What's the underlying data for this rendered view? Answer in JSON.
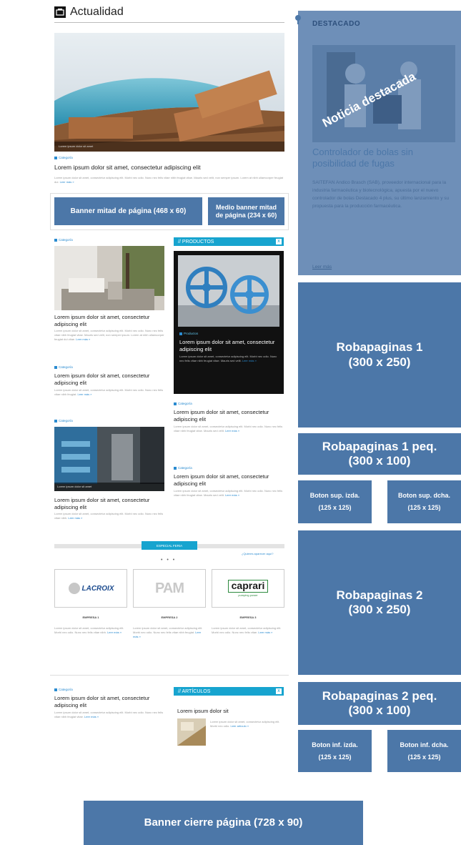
{
  "header": {
    "title": "Actualidad"
  },
  "hero": {
    "caption": "Lorem ipsum dolor sit amet",
    "category": "Categoría",
    "headline": "Lorem ipsum dolor sit amet, consectetur adipiscing elit",
    "body": "Lorem ipsum dolor sit amet, consectetur adipiscing elit. Morbi nec odio. Nunc nec felis vitae nibh feugiat vitae. Mauris sed velit, non semper ipsum. Lorem at nibh ullamcorper feugiat dui.",
    "more": "Leer más »"
  },
  "banners": {
    "half": "Banner mitad de página (468 x 60)",
    "medio": "Medio banner mitad de página (234 x 60)",
    "closing": "Banner cierre página (728 x 90)"
  },
  "articles": {
    "a1": {
      "category": "Categoría",
      "headline": "Lorem ipsum dolor sit amet, consectetur adipiscing elit",
      "body": "Lorem ipsum dolor sit amet, consectetur adipiscing elit. Morbi nec odio. Nunc nec felis vitae nibh feugiat vitae. Mauris sed velit, non semper ipsum. Lorem at nibh ullamcorper feugiat dui vitae.",
      "more": "Leer más »"
    },
    "a2": {
      "category": "Categoría",
      "headline": "Lorem ipsum dolor sit amet, consectetur adipiscing elit",
      "body": "Lorem ipsum dolor sit amet, consectetur adipiscing elit. Morbi nec odio. Nunc nec felis vitae nibh feugiat.",
      "more": "Leer más »"
    },
    "a3": {
      "category": "Categoría",
      "caption": "Lorem ipsum dolor sit amet",
      "headline": "Lorem ipsum dolor sit amet, consectetur adipiscing elit",
      "body": "Lorem ipsum dolor sit amet, consectetur adipiscing elit. Morbi nec odio. Nunc nec felis vitae nibh.",
      "more": "Leer más »"
    },
    "a4": {
      "category": "Categoría",
      "headline": "Lorem ipsum dolor sit amet, consectetur adipiscing elit",
      "body": "Lorem ipsum dolor sit amet, consectetur adipiscing elit. Morbi nec odio. Nunc nec felis vitae nibh feugiat vitae. Mauris sed velit.",
      "more": "Leer más »"
    },
    "a5": {
      "category": "Categoría",
      "headline": "Lorem ipsum dolor sit amet, consectetur adipiscing elit",
      "body": "Lorem ipsum dolor sit amet, consectetur adipiscing elit. Morbi nec odio. Nunc nec felis vitae nibh feugiat vitae. Mauris sed velit.",
      "more": "Leer más »"
    },
    "a6": {
      "category": "Categoría",
      "headline": "Lorem ipsum dolor sit amet, consectetur adipiscing elit",
      "body": "Lorem ipsum dolor sit amet, consectetur adipiscing elit. Morbi nec odio. Nunc nec felis vitae nibh feugiat vitae.",
      "more": "Leer más »"
    }
  },
  "productos": {
    "section": "// PRODUCTOS",
    "close": "x",
    "category": "Productos",
    "headline": "Lorem ipsum dolor sit amet, consectetur adipiscing elit",
    "body": "Lorem ipsum dolor sit amet, consectetur adipiscing elit. Morbi nec odio. Nunc nec felis vitae nibh feugiat vitae. Mauris sed velit.",
    "more": "Leer más »"
  },
  "empresas": {
    "bar": "ESPECIAL FERIA",
    "link": "¿Quieres aparecer aquí?",
    "dots": "• • •",
    "items": [
      {
        "logo": "LACROIX",
        "name": "EMPRESA 1",
        "body": "Lorem ipsum dolor sit amet, consectetur adipiscing elit. Morbi nec odio. Nunc nec felis vitae nibh.",
        "more": "Leer más »"
      },
      {
        "logo": "PAM",
        "name": "EMPRESA 2",
        "body": "Lorem ipsum dolor sit amet, consectetur adipiscing elit. Morbi nec odio. Nunc nec felis vitae nibh feugiat.",
        "more": "Leer más »"
      },
      {
        "logo": "caprari",
        "tagline": "pumping power",
        "name": "EMPRESA 3",
        "body": "Lorem ipsum dolor sit amet, consectetur adipiscing elit. Morbi nec odio. Nunc nec felis vitae.",
        "more": "Leer más »"
      }
    ]
  },
  "articulos": {
    "section": "// ARTÍCULOS",
    "close": "x",
    "headline": "Lorem ipsum dolor sit",
    "body": "Lorem ipsum dolor sit amet, consectetur adipiscing elit. Morbi nec odio.",
    "more": "Leer artículo »"
  },
  "destacado": {
    "label": "DESTACADO",
    "stamp": "Noticia destacada",
    "title": "Controlador de bolas sin posibilidad de fugas",
    "body": "SAITEFAN Andico Brasch (SAB), proveedor internacional para la industria farmacéutica y biotecnológica, apuesta por el nuevo controlador de bolas Destacado 4 plus, su último lanzamiento y su propuesta para la producción farmacéutica.",
    "more": "Leer más"
  },
  "side": {
    "roba1": [
      "Robapaginas 1",
      "(300 x 250)"
    ],
    "roba1peq": [
      "Robapaginas 1 peq.",
      "(300 x 100)"
    ],
    "botsup_izda": [
      "Boton sup. izda.",
      "(125 x 125)"
    ],
    "botsup_dcha": [
      "Boton sup. dcha.",
      "(125 x 125)"
    ],
    "roba2": [
      "Robapaginas 2",
      "(300 x 250)"
    ],
    "roba2peq": [
      "Robapaginas 2 peq.",
      "(300 x 100)"
    ],
    "botinf_izda": [
      "Boton inf. izda.",
      "(125 x 125)"
    ],
    "botinf_dcha": [
      "Boton inf. dcha.",
      "(125 x 125)"
    ]
  },
  "colors": {
    "banner": "#4c77a8",
    "accent": "#17a4cf",
    "link": "#2a8bd0"
  }
}
